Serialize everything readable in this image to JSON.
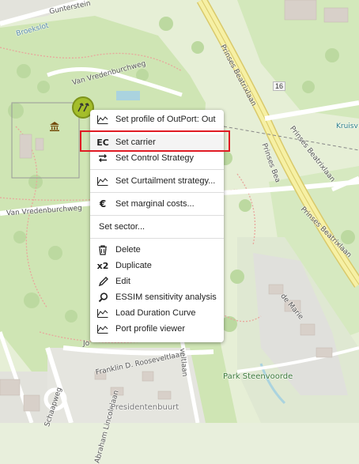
{
  "map": {
    "labels": {
      "gunterstein": "Gunterstein",
      "broekslot": "Broekslot",
      "van_vredenburchweg_top": "Van Vredenburchweg",
      "van_vredenburchweg_left": "Van Vredenburchweg",
      "prinses_beatrixlaan_1": "Prinses Beatrixlaan",
      "prinses_beatrixlaan_2": "Prinses Beatrixlaan",
      "prinses_beatrixlaan_3": "Prinses Beatrixlaan",
      "prinses_bea": "Prinses Bea",
      "kruisv": "Kruisv",
      "de_marie": "de Marie",
      "jo": "Jo",
      "franklin": "Franklin D. Rooseveltlaan",
      "abraham": "Abraham Lincolnlaan",
      "schaapweg": "Schaapweg",
      "veltlaan": "veltlaan",
      "park_steenvoorde": "Park Steenvoorde",
      "presidentenbuurt": "Presidentenbuurt",
      "road_number": "16"
    },
    "colors": {
      "park": "#c8e3ad",
      "grass": "#d9ebc3",
      "residential": "#e5e5e0",
      "motorway": "#f6f0a4",
      "path": "#e9a89a",
      "water": "#aad3df"
    }
  },
  "context_menu": {
    "items": [
      {
        "icon": "chart-icon",
        "label": "Set profile of OutPort: Out"
      },
      {
        "icon": "ec-icon",
        "glyph": "EC",
        "label": "Set carrier"
      },
      {
        "icon": "swap-arrows-icon",
        "label": "Set Control Strategy"
      },
      {
        "icon": "chart-icon",
        "label": "Set Curtailment strategy..."
      },
      {
        "icon": "euro-icon",
        "glyph": "€",
        "label": "Set marginal costs..."
      },
      {
        "label": "Set sector..."
      },
      {
        "icon": "trash-icon",
        "label": "Delete"
      },
      {
        "icon": "x2-icon",
        "glyph": "x2",
        "label": "Duplicate"
      },
      {
        "icon": "pencil-icon",
        "label": "Edit"
      },
      {
        "icon": "magnifier-icon",
        "label": "ESSIM sensitivity analysis"
      },
      {
        "icon": "chart-icon",
        "label": "Load Duration Curve"
      },
      {
        "icon": "chart-icon",
        "label": "Port profile viewer"
      }
    ],
    "highlighted_item": "Set carrier",
    "highlight_color": "#e01b24"
  }
}
